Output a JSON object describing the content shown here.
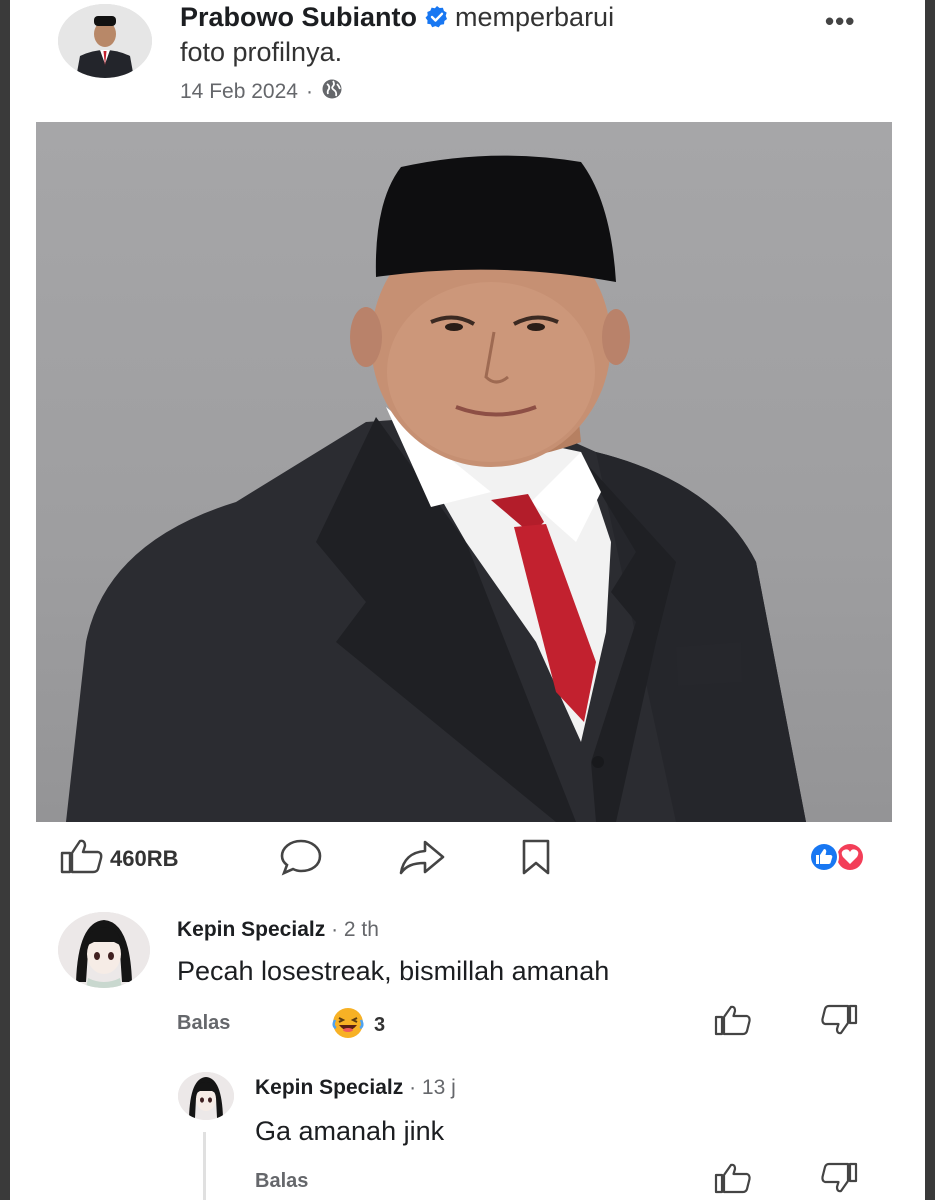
{
  "post": {
    "author": "Prabowo Subianto",
    "action_line1": "memperbarui",
    "action_line2": "foto profilnya.",
    "date": "14 Feb 2024",
    "separator": "·",
    "more_label": "•••"
  },
  "action_bar": {
    "like_count": "460RB"
  },
  "comments": [
    {
      "author": "Kepin Specialz",
      "time": "· 2 th",
      "text": "Pecah losestreak, bismillah  amanah",
      "reply_label": "Balas",
      "reaction_count": "3"
    },
    {
      "author": "Kepin Specialz",
      "time": "· 13 j",
      "text": "Ga amanah jink",
      "reply_label": "Balas"
    }
  ],
  "colors": {
    "verified_blue": "#1877f2",
    "like_blue": "#1877f2",
    "love_red": "#f33e58",
    "text_primary": "#1c1e21",
    "text_secondary": "#65676b"
  }
}
